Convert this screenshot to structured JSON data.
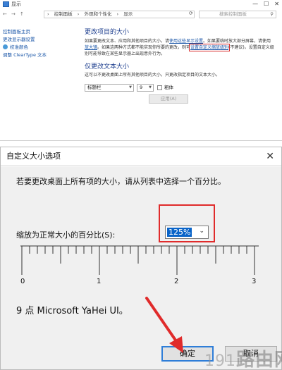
{
  "control_panel": {
    "window_title": "显示",
    "window_controls": [
      "—",
      "☐",
      "✕"
    ],
    "nav": {
      "back": "←",
      "forward": "→",
      "up": "↑"
    },
    "breadcrumb": [
      "控制面板",
      "外观和个性化",
      "显示"
    ],
    "breadcrumb_sep": "›",
    "search_placeholder": "搜索控制面板",
    "sidebar": [
      "控制面板主页",
      "更改显示器设置",
      "校准颜色",
      "调整 ClearType 文本"
    ],
    "section1_title": "更改项目的大小",
    "section1_text_a": "如果要更改文本、应用和其他项目的大小，请",
    "section1_link1": "使用这些显示设置",
    "section1_text_b": "。如果要临时放大部分屏幕，请使用",
    "section1_link2": "放大镜",
    "section1_text_c": "。如果这两种方式都不能实现你所要的更改，则可",
    "section1_link3": "设置自定义缩放级别",
    "section1_text_d": "(不建议)。设置自定义级别可能导致在某些显示器上出现意外行为。",
    "section2_title": "仅更改文本大小",
    "section2_text": "这可以不更改桌面上所有其他项目的大小，只更改指定项目的文本大小。",
    "item_select": "标题栏",
    "size_select": "9",
    "bold_label": "粗体",
    "apply_label": "应用(A)"
  },
  "dialog": {
    "title": "自定义大小选项",
    "close": "✕",
    "prompt": "若要更改桌面上所有项的大小，请从列表中选择一个百分比。",
    "scale_label": "缩放为正常大小的百分比(S):",
    "scale_value": "125%",
    "ruler_labels": [
      "0",
      "1",
      "2",
      "3"
    ],
    "sample_text": "9 点 Microsoft YaHei UI。",
    "ok_label": "确定",
    "cancel_label": "取消"
  },
  "watermark": {
    "num": "191",
    "text": "路由网"
  },
  "colors": {
    "highlight_red": "#e02b2b",
    "link_blue": "#1a56a8",
    "select_blue": "#0a64c8"
  }
}
